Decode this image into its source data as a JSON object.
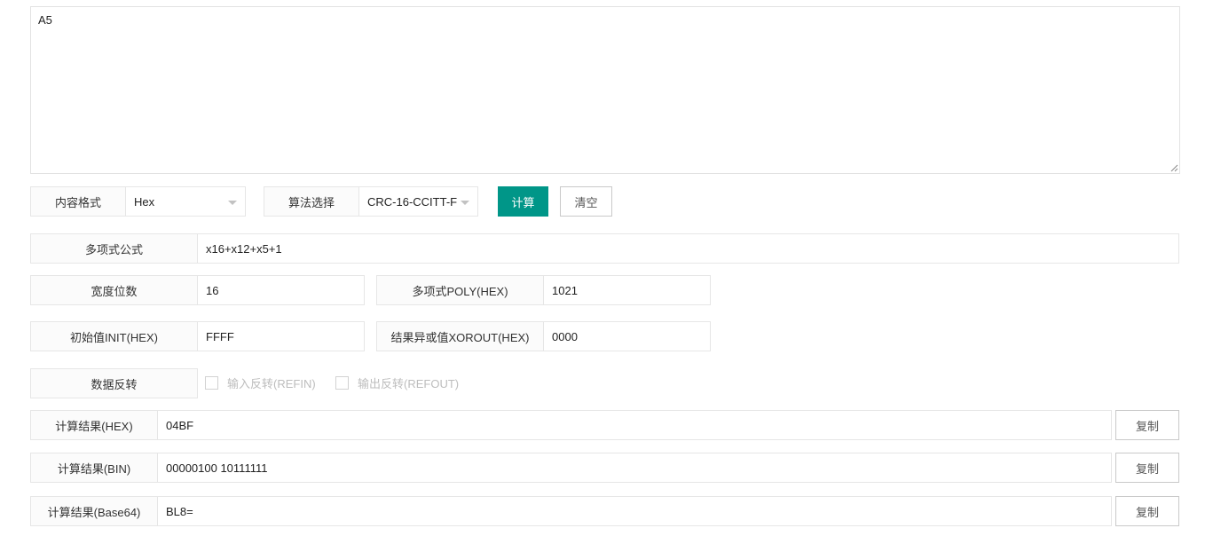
{
  "input": {
    "value": "A5"
  },
  "format": {
    "label": "内容格式",
    "selected": "Hex"
  },
  "algorithm": {
    "label": "算法选择",
    "selected": "CRC-16-CCITT-F"
  },
  "buttons": {
    "calculate": "计算",
    "clear": "清空",
    "copy": "复制"
  },
  "params": {
    "polynomial_formula": {
      "label": "多项式公式",
      "value": "x16+x12+x5+1"
    },
    "width": {
      "label": "宽度位数",
      "value": "16"
    },
    "poly": {
      "label": "多项式POLY(HEX)",
      "value": "1021"
    },
    "init": {
      "label": "初始值INIT(HEX)",
      "value": "FFFF"
    },
    "xorout": {
      "label": "结果异或值XOROUT(HEX)",
      "value": "0000"
    }
  },
  "reflect": {
    "label": "数据反转",
    "refin": {
      "label": "输入反转(REFIN)",
      "checked": false
    },
    "refout": {
      "label": "输出反转(REFOUT)",
      "checked": false
    }
  },
  "results": {
    "hex": {
      "label": "计算结果(HEX)",
      "value": "04BF"
    },
    "bin": {
      "label": "计算结果(BIN)",
      "value": "00000100 10111111"
    },
    "base64": {
      "label": "计算结果(Base64)",
      "value": "BL8="
    }
  },
  "colors": {
    "primary": "#009688",
    "border": "#e6e6e6",
    "label_bg": "#fbfbfb"
  }
}
